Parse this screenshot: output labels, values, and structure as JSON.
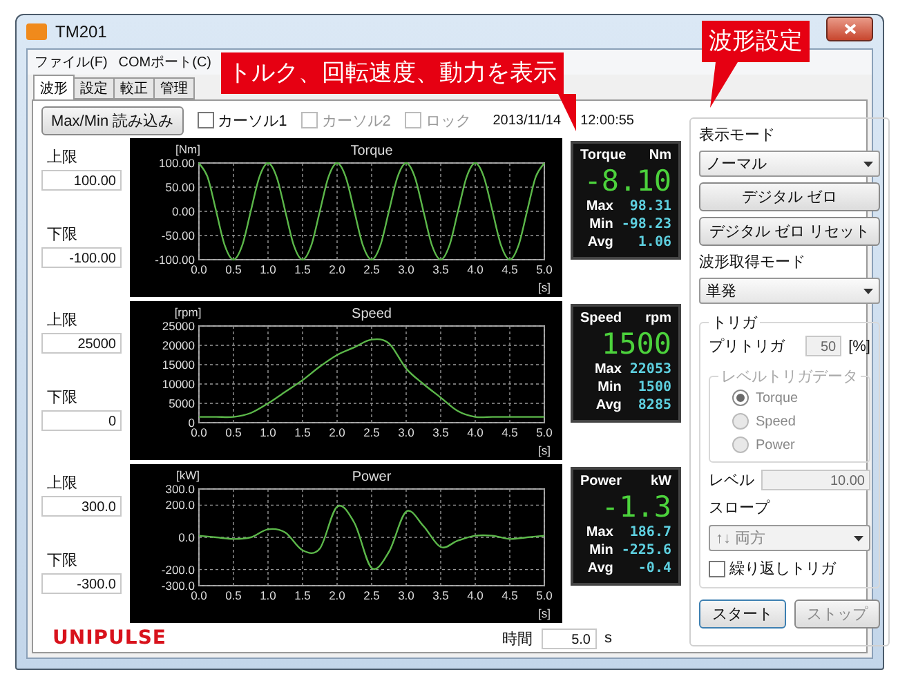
{
  "window": {
    "title": "TM201"
  },
  "menu": [
    "ファイル(F)",
    "COMポート(C)"
  ],
  "tabs": [
    {
      "label": "波形",
      "selected": true
    },
    {
      "label": "設定",
      "selected": false
    },
    {
      "label": "較正",
      "selected": false
    },
    {
      "label": "管理",
      "selected": false
    }
  ],
  "toolbar": {
    "button": "Max/Min 読み込み",
    "checkboxes": [
      {
        "label": "カーソル1",
        "checked": false,
        "disabled": false
      },
      {
        "label": "カーソル2",
        "checked": false,
        "disabled": true
      },
      {
        "label": "ロック",
        "checked": false,
        "disabled": true
      }
    ],
    "date": "2013/11/14",
    "time": "12:00:55"
  },
  "rows": [
    {
      "upper_label": "上限",
      "upper": "100.00",
      "lower_label": "下限",
      "lower": "-100.00",
      "chart_data": {
        "type": "line",
        "title": "Torque",
        "xlabel": "[s]",
        "ylabel": "[Nm]",
        "grid": true,
        "x": [
          0,
          0.125,
          0.25,
          0.375,
          0.5,
          0.625,
          0.75,
          0.875,
          1,
          1.125,
          1.25,
          1.375,
          1.5,
          1.625,
          1.75,
          1.875,
          2,
          2.125,
          2.25,
          2.375,
          2.5,
          2.625,
          2.75,
          2.875,
          3,
          3.125,
          3.25,
          3.375,
          3.5,
          3.625,
          3.75,
          3.875,
          4,
          4.125,
          4.25,
          4.375,
          4.5,
          4.625,
          4.75,
          4.875,
          5
        ],
        "series": [
          {
            "color": "#5cb84a",
            "values": [
              100,
              71,
              0,
              -71,
              -100,
              -71,
              0,
              71,
              100,
              71,
              0,
              -71,
              -100,
              -71,
              0,
              71,
              100,
              71,
              0,
              -71,
              -100,
              -71,
              0,
              71,
              100,
              71,
              0,
              -71,
              -100,
              -71,
              0,
              71,
              100,
              71,
              0,
              -71,
              -100,
              -71,
              0,
              71,
              100
            ]
          }
        ],
        "xlim": [
          0,
          5
        ],
        "ylim": [
          -100,
          100
        ],
        "xticks": [
          {
            "value": 0,
            "label": "0.0"
          },
          {
            "value": 0.5,
            "label": "0.5"
          },
          {
            "value": 1,
            "label": "1.0"
          },
          {
            "value": 1.5,
            "label": "1.5"
          },
          {
            "value": 2,
            "label": "2.0"
          },
          {
            "value": 2.5,
            "label": "2.5"
          },
          {
            "value": 3,
            "label": "3.0"
          },
          {
            "value": 3.5,
            "label": "3.5"
          },
          {
            "value": 4,
            "label": "4.0"
          },
          {
            "value": 4.5,
            "label": "4.5"
          },
          {
            "value": 5,
            "label": "5.0"
          }
        ],
        "yticks": [
          {
            "value": 100,
            "label": "100.00"
          },
          {
            "value": 50,
            "label": "50.00"
          },
          {
            "value": 0,
            "label": "0.00"
          },
          {
            "value": -50,
            "label": "-50.00"
          },
          {
            "value": -100,
            "label": "-100.00"
          }
        ]
      },
      "readout": {
        "name": "Torque",
        "unit": "Nm",
        "value": "-8.10",
        "stats": [
          {
            "label": "Max",
            "value": "98.31"
          },
          {
            "label": "Min",
            "value": "-98.23"
          },
          {
            "label": "Avg",
            "value": "1.06"
          }
        ]
      }
    },
    {
      "upper_label": "上限",
      "upper": "25000",
      "lower_label": "下限",
      "lower": "0",
      "chart_data": {
        "type": "line",
        "title": "Speed",
        "xlabel": "[s]",
        "ylabel": "[rpm]",
        "grid": true,
        "x": [
          0,
          0.25,
          0.5,
          0.75,
          1,
          1.25,
          1.5,
          1.75,
          2,
          2.25,
          2.5,
          2.75,
          3,
          3.25,
          3.5,
          3.75,
          4,
          4.25,
          4.5,
          4.75,
          5
        ],
        "series": [
          {
            "color": "#5cb84a",
            "values": [
              1500,
              1500,
              1500,
              2500,
              5000,
              8000,
              11000,
              14500,
              17500,
              19500,
              21500,
              20500,
              14000,
              10000,
              6500,
              3000,
              1500,
              1500,
              1500,
              1500,
              1500
            ]
          }
        ],
        "xlim": [
          0,
          5
        ],
        "ylim": [
          0,
          25000
        ],
        "xticks": [
          {
            "value": 0,
            "label": "0.0"
          },
          {
            "value": 0.5,
            "label": "0.5"
          },
          {
            "value": 1,
            "label": "1.0"
          },
          {
            "value": 1.5,
            "label": "1.5"
          },
          {
            "value": 2,
            "label": "2.0"
          },
          {
            "value": 2.5,
            "label": "2.5"
          },
          {
            "value": 3,
            "label": "3.0"
          },
          {
            "value": 3.5,
            "label": "3.5"
          },
          {
            "value": 4,
            "label": "4.0"
          },
          {
            "value": 4.5,
            "label": "4.5"
          },
          {
            "value": 5,
            "label": "5.0"
          }
        ],
        "yticks": [
          25000,
          20000,
          15000,
          10000,
          5000,
          0
        ]
      },
      "readout": {
        "name": "Speed",
        "unit": "rpm",
        "value": "1500",
        "stats": [
          {
            "label": "Max",
            "value": "22053"
          },
          {
            "label": "Min",
            "value": "1500"
          },
          {
            "label": "Avg",
            "value": "8285"
          }
        ]
      }
    },
    {
      "upper_label": "上限",
      "upper": "300.0",
      "lower_label": "下限",
      "lower": "-300.0",
      "chart_data": {
        "type": "line",
        "title": "Power",
        "xlabel": "[s]",
        "ylabel": "[kW]",
        "grid": true,
        "x": [
          0,
          0.25,
          0.5,
          0.75,
          1,
          1.25,
          1.5,
          1.75,
          2,
          2.25,
          2.5,
          2.75,
          3,
          3.25,
          3.5,
          3.75,
          4,
          4.25,
          4.5,
          4.75,
          5
        ],
        "series": [
          {
            "color": "#5cb84a",
            "values": [
              10,
              0,
              -10,
              0,
              50,
              30,
              -80,
              -70,
              190,
              90,
              -190,
              -90,
              160,
              70,
              -60,
              -20,
              10,
              10,
              -10,
              0,
              10
            ]
          }
        ],
        "xlim": [
          0,
          5
        ],
        "ylim": [
          -300,
          300
        ],
        "xticks": [
          {
            "value": 0,
            "label": "0.0"
          },
          {
            "value": 0.5,
            "label": "0.5"
          },
          {
            "value": 1,
            "label": "1.0"
          },
          {
            "value": 1.5,
            "label": "1.5"
          },
          {
            "value": 2,
            "label": "2.0"
          },
          {
            "value": 2.5,
            "label": "2.5"
          },
          {
            "value": 3,
            "label": "3.0"
          },
          {
            "value": 3.5,
            "label": "3.5"
          },
          {
            "value": 4,
            "label": "4.0"
          },
          {
            "value": 4.5,
            "label": "4.5"
          },
          {
            "value": 5,
            "label": "5.0"
          }
        ],
        "yticks": [
          {
            "value": 300,
            "label": "300.0"
          },
          {
            "value": 200,
            "label": "200.0"
          },
          {
            "value": 0,
            "label": "0.0"
          },
          {
            "value": -200,
            "label": "-200.0"
          },
          {
            "value": -300,
            "label": "-300.0"
          }
        ]
      },
      "readout": {
        "name": "Power",
        "unit": "kW",
        "value": "-1.3",
        "stats": [
          {
            "label": "Max",
            "value": "186.7"
          },
          {
            "label": "Min",
            "value": "-225.6"
          },
          {
            "label": "Avg",
            "value": "-0.4"
          }
        ]
      }
    }
  ],
  "footer": {
    "logo": "UNIPULSE",
    "time_label": "時間",
    "time": "5.0",
    "time_unit": "s"
  },
  "settings": {
    "display_mode_label": "表示モード",
    "display_mode": "ノーマル",
    "zero_buttons": [
      {
        "label": "デジタル ゼロ",
        "disabled": false
      },
      {
        "label": "デジタル ゼロ リセット",
        "disabled": false
      }
    ],
    "acquire_mode_label": "波形取得モード",
    "acquire_mode": "単発",
    "trigger": {
      "title": "トリガ",
      "pretrigger_label": "プリトリガ",
      "pretrigger": "50",
      "pretrigger_unit": "[%]",
      "disabled": true,
      "level_group": "レベルトリガデータ",
      "sources": [
        {
          "label": "Torque",
          "selected": true
        },
        {
          "label": "Speed",
          "selected": false
        },
        {
          "label": "Power",
          "selected": false
        }
      ],
      "level_label": "レベル",
      "level": "10.00",
      "slope_label": "スロープ",
      "slope": "↑↓  両方",
      "repeat": {
        "label": "繰り返しトリガ",
        "checked": false
      }
    },
    "actions": [
      {
        "label": "スタート",
        "disabled": false,
        "default": true
      },
      {
        "label": "ストップ",
        "disabled": true,
        "default": false
      }
    ]
  },
  "callouts": [
    {
      "text": "トルク、回転速度、動力を表示"
    },
    {
      "text": "波形設定"
    }
  ]
}
